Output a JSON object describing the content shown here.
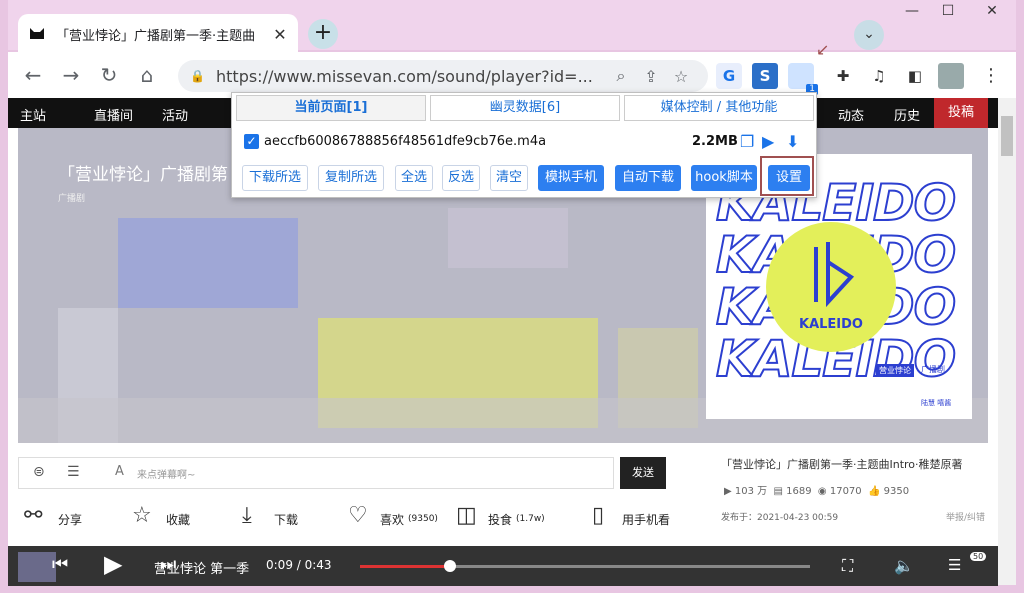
{
  "window": {
    "minimize": "—",
    "maximize": "☐",
    "close": "✕"
  },
  "tab": {
    "title": "「营业悖论」广播剧第一季·主题曲",
    "close": "✕",
    "new_tab": "+",
    "search_tabs": "⌄"
  },
  "toolbar": {
    "back": "←",
    "forward": "→",
    "reload": "↻",
    "home": "⌂",
    "lock": "🔒",
    "url": "https://www.missevan.com/sound/player?id=...",
    "zoom": "⌕",
    "share": "⇪",
    "star": "☆",
    "ext_badge": "1",
    "menu": "⋮"
  },
  "sitenav": {
    "items": [
      "主站",
      "直播间",
      "活动",
      "动态",
      "历史",
      "投稿"
    ]
  },
  "hero": {
    "title": "「营业悖论」广播剧第",
    "sub": "广播剧"
  },
  "cover": {
    "word": "KALEIDO",
    "logo": "KALEIDO",
    "tag1": "营业悖论",
    "tag2": "广播剧",
    "tag3": "陆慧 嘻酱"
  },
  "danmu": {
    "placeholder": "来点弹幕啊~",
    "send": "发送"
  },
  "actions": [
    {
      "icon": "share-icon",
      "glyph": "⚯",
      "label": "分享"
    },
    {
      "icon": "star-icon",
      "glyph": "☆",
      "label": "收藏"
    },
    {
      "icon": "download-icon",
      "glyph": "⤓",
      "label": "下载"
    },
    {
      "icon": "heart-icon",
      "glyph": "♡",
      "label": "喜欢",
      "count": "(9350)"
    },
    {
      "icon": "coin-icon",
      "glyph": "◫",
      "label": "投食",
      "count": "(1.7w)"
    },
    {
      "icon": "phone-icon",
      "glyph": "▯",
      "label": "用手机看"
    }
  ],
  "side": {
    "title": "「营业悖论」广播剧第一季·主题曲Intro·稚楚原著",
    "plays": "103 万",
    "comments": "1689",
    "danmaku": "17070",
    "likes": "9350",
    "date": "发布于：2021-04-23 00:59",
    "report": "举报/纠错"
  },
  "player": {
    "title": "营业悖论 第一季",
    "time": "0:09 / 0:43",
    "progress": 0.2,
    "badge": "50"
  },
  "popup": {
    "tabs": [
      "当前页面[1]",
      "幽灵数据[6]",
      "媒体控制 / 其他功能"
    ],
    "file": {
      "name": "aeccfb60086788856f48561dfe9cb76e.m4a",
      "size": "2.2MB",
      "checked": true
    },
    "buttons": [
      "下载所选",
      "复制所选",
      "全选",
      "反选",
      "清空",
      "模拟手机",
      "自动下载",
      "hook脚本",
      "设置"
    ]
  },
  "colors": {
    "accent": "#1a73e8",
    "popup_blue": "#2d7ff0",
    "highlight": "#a05050",
    "nav_red": "#c0282c"
  }
}
